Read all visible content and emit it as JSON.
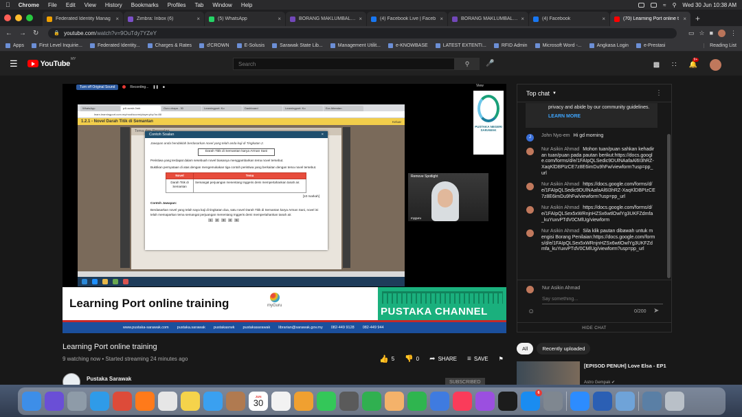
{
  "menubar": {
    "app": "Chrome",
    "items": [
      "File",
      "Edit",
      "View",
      "History",
      "Bookmarks",
      "Profiles",
      "Tab",
      "Window",
      "Help"
    ],
    "clock": "Wed 30 Jun  10:38 AM"
  },
  "tabs": [
    {
      "label": "Federated Identity Manag",
      "color": "#f0a000"
    },
    {
      "label": "Zimbra: Inbox (6)",
      "color": "#7b50c8"
    },
    {
      "label": "(5) WhatsApp",
      "color": "#25d366"
    },
    {
      "label": "BORANG MAKLUMBALAS",
      "color": "#7248b9"
    },
    {
      "label": "(4) Facebook Live | Faceb",
      "color": "#1877f2"
    },
    {
      "label": "BORANG MAKLUMBALAS",
      "color": "#7248b9"
    },
    {
      "label": "(4) Facebook",
      "color": "#1877f2"
    },
    {
      "label": "(70) Learning Port online t",
      "color": "#ff0000"
    }
  ],
  "address": {
    "host": "youtube.com",
    "path": "/watch?v=9OuTdy7YZeY"
  },
  "bookmarks": [
    "Apps",
    "First Level Inquirie...",
    "Federated Identity...",
    "Charges & Rates",
    "d'CROWN",
    "E-Solusis",
    "Sarawak State Lib...",
    "Management Utilit...",
    "e-KNOWBASE",
    "LATEST EXTENTI...",
    "RFID Admin",
    "Microsoft Word -...",
    "Angkasa Login",
    "e-Prestasi"
  ],
  "bookmarks_reading": "Reading List",
  "youtube": {
    "logo": "YouTube",
    "region": "MY",
    "search_placeholder": "Search",
    "notif_count": "9+"
  },
  "player": {
    "original_sound": "Turn off Original Sound",
    "recording": "Recording...",
    "view": "View",
    "shared_tabs": [
      "WhatsApp",
      "p4l-scrsh-0mb",
      "Guru chapa - 30",
      "Learningport: Ko",
      "Dashboard",
      "Learningport: Ko",
      "Ezx Attendan"
    ],
    "shared_url": "learn.learningport.com.my/mod/scorm/player.php?a=88",
    "lms_title": "1.2.1 - Novel Darah Titik di Semantan",
    "lms_exit": "Keluar",
    "panel_title": "Tema dan Persoalan",
    "modal": {
      "title": "Contoh Soalan",
      "question": "Jawapan anda hendaklah berdasarkan novel yang telah anda kaji di Tingkatan 2.",
      "novel": "Darah Titik di Semantan karya Arman Sani",
      "line1": "Peristiwa yang terdapat dalam sesebuah novel biasanya menggambarkan tema novel tersebut.",
      "line2": "Buktikan pernyataan di atas dengan mengemukakan tiga contoh peristiwa yang berkaitan dengan tema novel tersebut.",
      "table_headers": [
        "Novel",
        "Tema"
      ],
      "table_row": [
        "Darah Titik di Semantan",
        "Semangat perjuangan menentang Inggeris demi mempertahankan tanah air."
      ],
      "marks": "[10 markah]",
      "answer_label": "Contoh Jawapan:",
      "answer": "Berdasarkan novel yang telah saya kaji di tingkatan dua, satu novel Darah Titik di Semantan karya Arman Sani, novel ini telah memaparkan tema semangat perjuangan menentang Inggeris demi mempertahankan tanah air."
    },
    "pages": [
      "1",
      "2",
      "3",
      "4",
      "5"
    ],
    "spotlight": "Remove Spotlight",
    "cam_name": "myguru",
    "org_logo": "PUSTAKA NEGERI SARAWAK",
    "banner_title": "Learning Port online training",
    "myguru": "myGuru",
    "channel": "PUSTAKA CHANNEL",
    "footer": [
      "www.pustaka-sarawak.com",
      "pustaka.sarawak",
      "pustakasrwk",
      "pustakasarawak",
      "librarian@sarawak.gov.my",
      "082-449 9128",
      "082-449 944"
    ]
  },
  "video": {
    "title": "Learning Port online training",
    "meta": "9 watching now • Started streaming 24 minutes ago",
    "likes": "5",
    "dislikes": "0",
    "share": "SHARE",
    "save": "SAVE",
    "channel": "Pustaka Sarawak",
    "subscribe": "SUBSCRIBED"
  },
  "chat": {
    "header": "Top chat",
    "pinned_text": "privacy and abide by our community guidelines.",
    "learn_more": "LEARN MORE",
    "messages": [
      {
        "author": "John Nyo-em",
        "text": "Hi gd morning",
        "color": "#3a6fd8",
        "initial": "J"
      },
      {
        "author": "Nur Asikin Ahmad",
        "text": "Mohon tuan/puan sahkan kehadiran tuan/puan pada pautan berikut:https://docs.google.com/forms/d/e/1FAIpQLSedic9DUlNAafaAl6I3hRZ-XaqKlDBPIzCE7z8E6imDu9hFw/viewform?usp=pp_url",
        "color": "#c0785c",
        "initial": ""
      },
      {
        "author": "Nur Asikin Ahmad",
        "text": "https://docs.google.com/forms/d/e/1FAIpQLSedic9DUlNAafaAl6I3hRZ-XaqKlDBPIzCE7z8E6imDu9hFw/viewform?usp=pp_url",
        "color": "#c0785c",
        "initial": ""
      },
      {
        "author": "Nur Asikin Ahmad",
        "text": "https://docs.google.com/forms/d/e/1FAIpQLSex5xWRnjnHZSx6wtlOwlYg3UKFZdmfa_kuYuxvPTdV0CMlUg/viewform",
        "color": "#c0785c",
        "initial": ""
      },
      {
        "author": "Nur Asikin Ahmad",
        "text": "Sila klik pautan dibawah untuk mengisi Borang Penilaian:https://docs.google.com/forms/d/e/1FAIpQLSex5xWRnjnHZSx6wtlOwlYg3UKFZdmfa_kuYuxvPTdV0CMlUg/viewform?usp=pp_url",
        "color": "#c0785c",
        "initial": ""
      }
    ],
    "composer_name": "Nur Asikin Ahmad",
    "composer_placeholder": "Say something...",
    "char_count": "0/200",
    "hide_chat": "HIDE CHAT"
  },
  "chips": [
    "All",
    "Recently uploaded"
  ],
  "recommended": {
    "title": "[EPISOD PENUH] Love Elsa - EP1",
    "channel": "Astro Gempak ✔"
  },
  "dock": {
    "calendar_month": "JUN",
    "calendar_day": "30",
    "appstore_badge": "6",
    "apps": [
      {
        "name": "finder",
        "color": "#3d8ee8"
      },
      {
        "name": "siri",
        "color": "#6a4fd6"
      },
      {
        "name": "launchpad",
        "color": "#8e9ba8"
      },
      {
        "name": "safari",
        "color": "#2f9be8"
      },
      {
        "name": "chrome",
        "color": "#dd4b39"
      },
      {
        "name": "firefox",
        "color": "#ff7a1a"
      },
      {
        "name": "file",
        "color": "#e6e6e6"
      },
      {
        "name": "notes",
        "color": "#f5d34b"
      },
      {
        "name": "mail",
        "color": "#3aa0f0"
      },
      {
        "name": "contacts",
        "color": "#b07a50"
      }
    ],
    "apps2": [
      {
        "name": "reminders",
        "color": "#f2f2f2"
      },
      {
        "name": "photos",
        "color": "#f0a030"
      },
      {
        "name": "messages",
        "color": "#34c759"
      },
      {
        "name": "calculator",
        "color": "#5a5a5a"
      },
      {
        "name": "facetime",
        "color": "#30b050"
      },
      {
        "name": "freeform",
        "color": "#f4b26a"
      },
      {
        "name": "numbers",
        "color": "#2fb54f"
      },
      {
        "name": "keynote",
        "color": "#3f7be0"
      },
      {
        "name": "music",
        "color": "#fa3c5a"
      },
      {
        "name": "podcasts",
        "color": "#9b4fe0"
      },
      {
        "name": "tv",
        "color": "#1c1c1c"
      }
    ],
    "apps3": [
      {
        "name": "system-preferences",
        "color": "#7f8790"
      },
      {
        "name": "zoom",
        "color": "#2d8cff"
      },
      {
        "name": "word",
        "color": "#2b5fb4"
      },
      {
        "name": "preview",
        "color": "#6fa3d8"
      },
      {
        "name": "downloads",
        "color": "#5a7fa5"
      },
      {
        "name": "trash",
        "color": "#b9c0c8"
      }
    ]
  }
}
